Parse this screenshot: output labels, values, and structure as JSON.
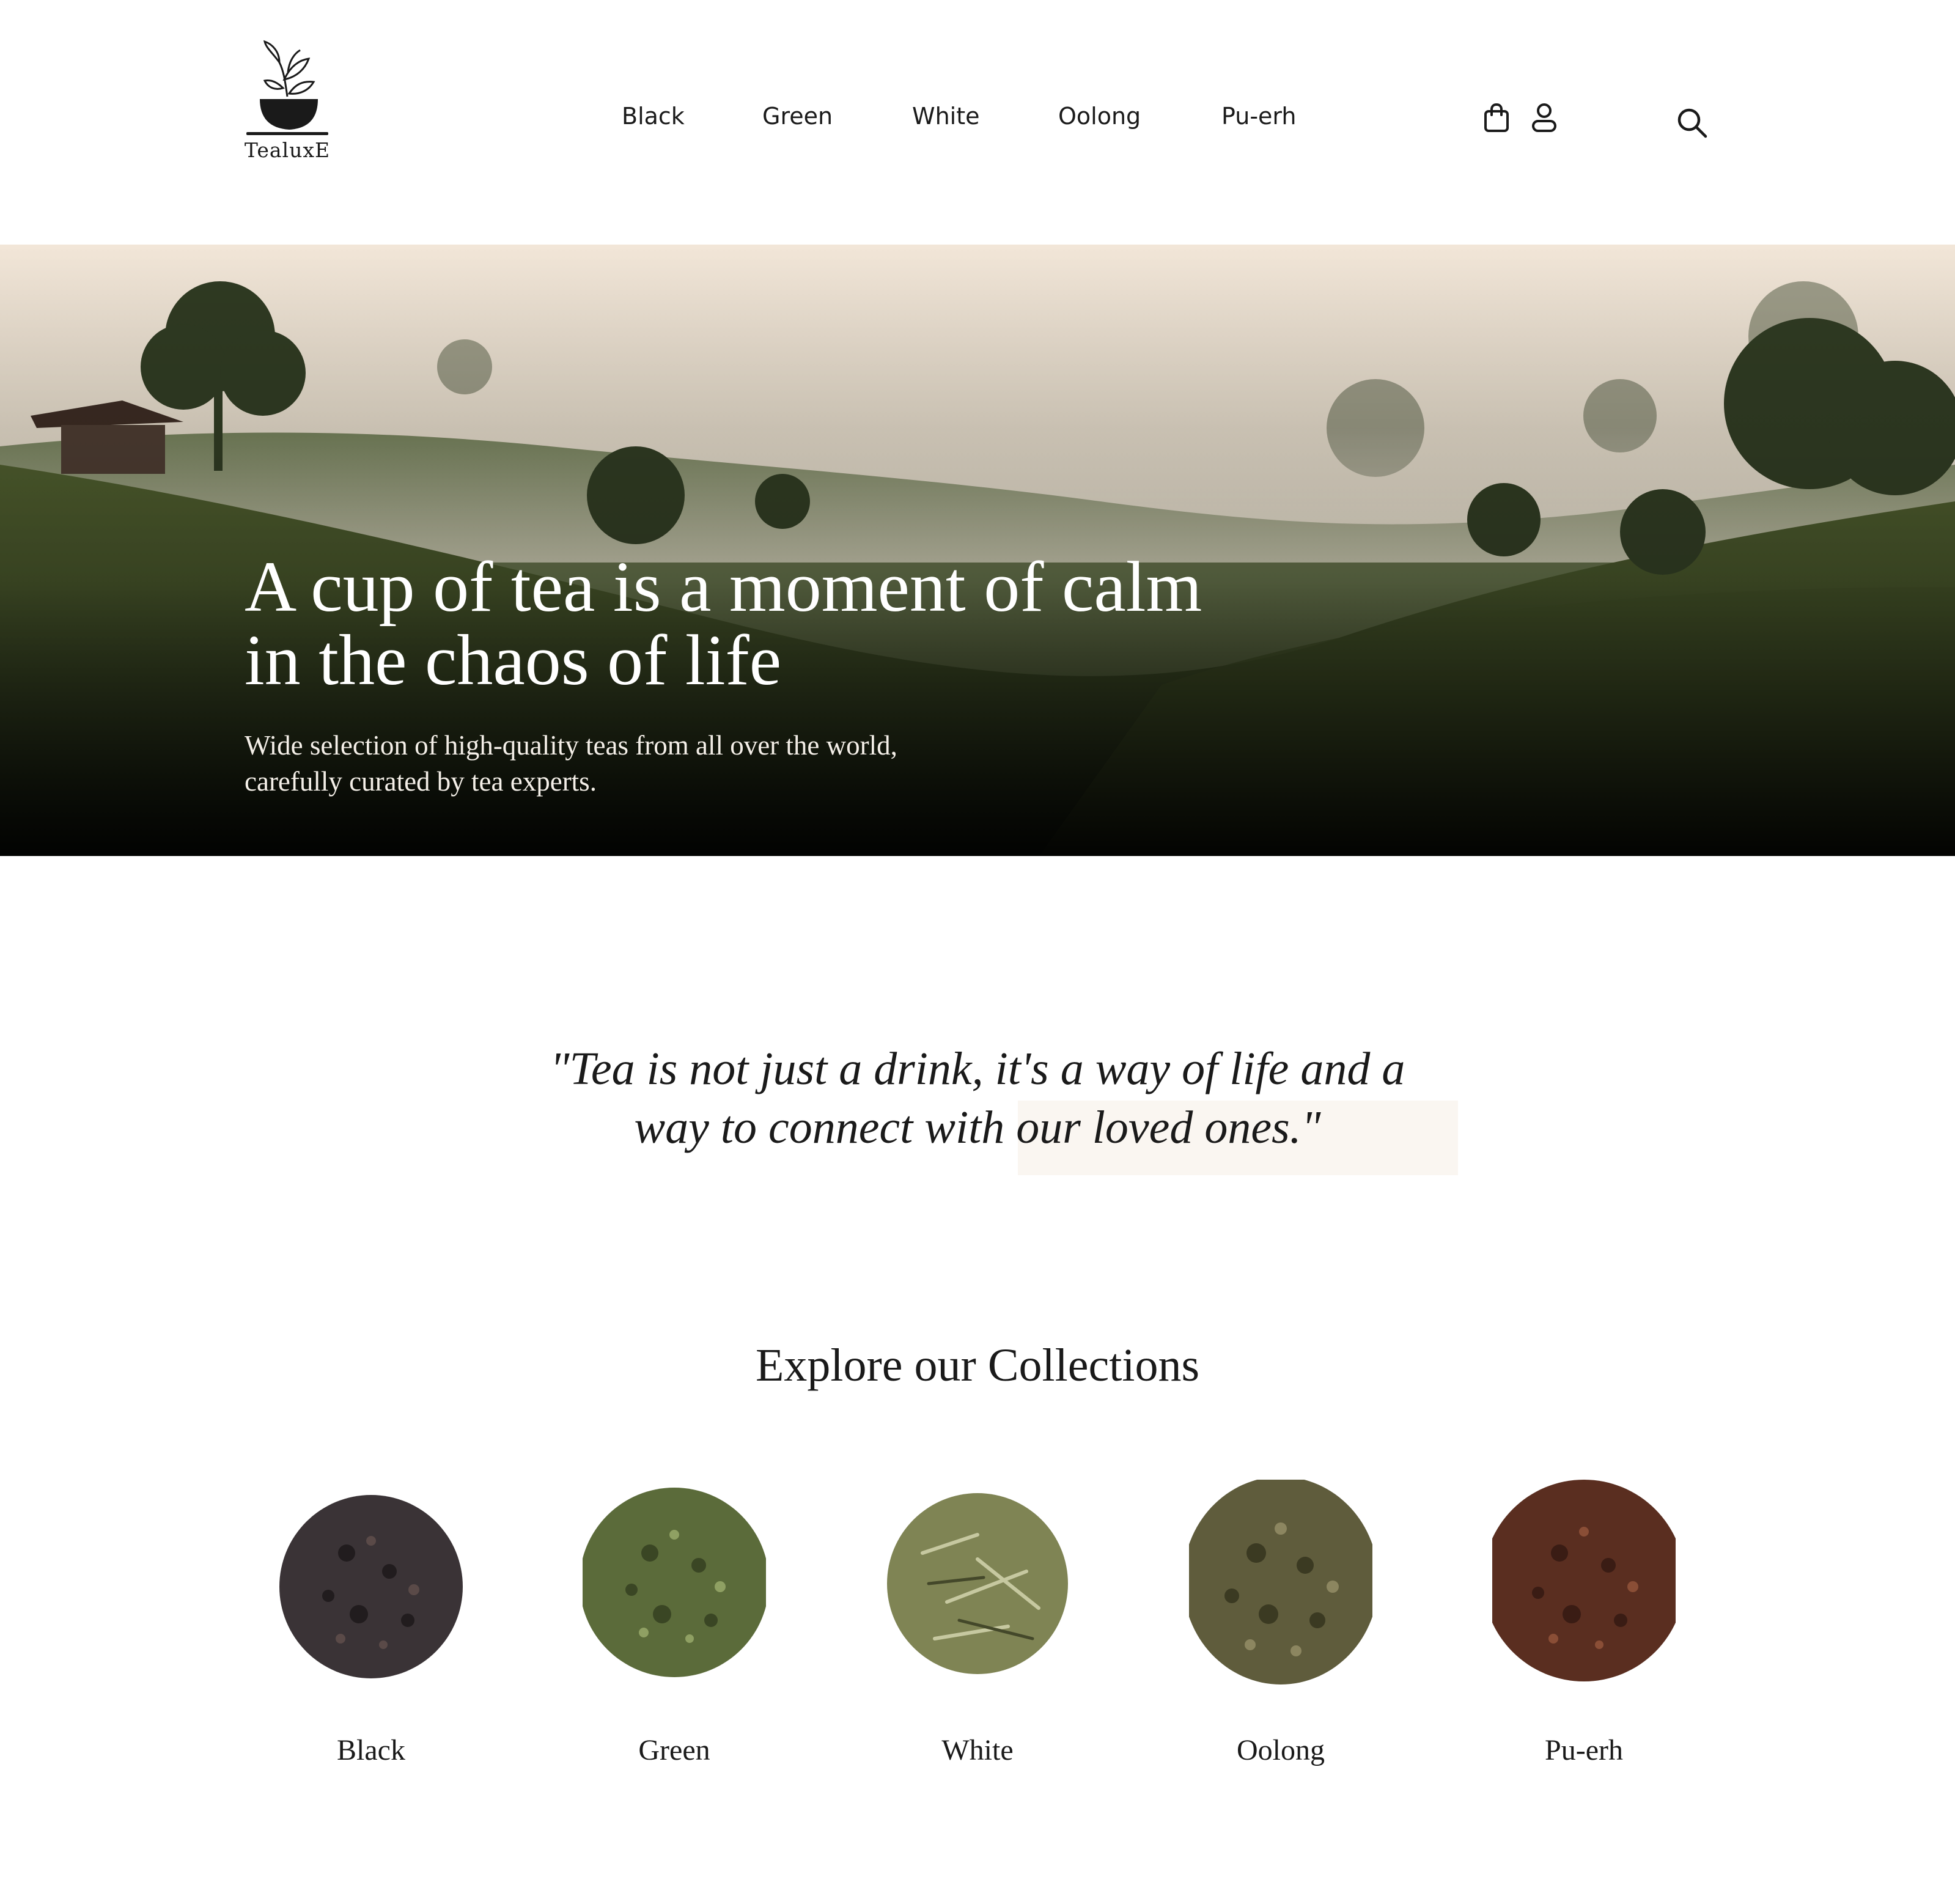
{
  "brand": {
    "name": "TealuxE"
  },
  "nav": {
    "items": [
      "Black",
      "Green",
      "White",
      "Oolong",
      "Pu-erh"
    ]
  },
  "header_icons": [
    "shopping-bag-icon",
    "user-icon",
    "search-icon"
  ],
  "hero": {
    "title_lines": [
      "A cup of tea is a moment of calm",
      "in the chaos of life"
    ],
    "subtitle_lines": [
      "Wide selection of high-quality teas from all over the world,",
      "carefully curated by tea experts."
    ]
  },
  "quote": {
    "lines": [
      "\"Tea is not just a drink, it's a way of life and a",
      "way to connect with our loved ones.\""
    ]
  },
  "collections": {
    "title": "Explore our Collections",
    "items": [
      {
        "label": "Black",
        "color": "#3a3336"
      },
      {
        "label": "Green",
        "color": "#5b6b3a"
      },
      {
        "label": "White",
        "color": "#7f8454"
      },
      {
        "label": "Oolong",
        "color": "#5f5c3c"
      },
      {
        "label": "Pu-erh",
        "color": "#5a2e20"
      }
    ]
  },
  "colors": {
    "text": "#1a1a1a",
    "quote_highlight": "#faf6f1"
  }
}
